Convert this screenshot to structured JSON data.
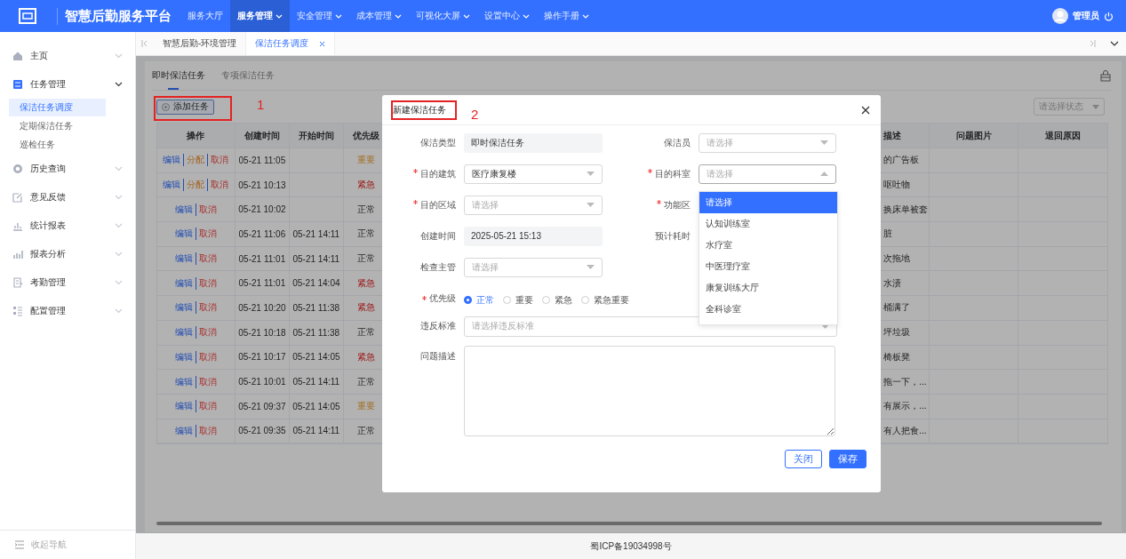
{
  "topbar": {
    "title": "智慧后勤服务平台",
    "user": "管理员",
    "nav": [
      {
        "label": "服务大厅",
        "selected": false,
        "dropdown": false
      },
      {
        "label": "服务管理",
        "selected": true,
        "dropdown": true
      },
      {
        "label": "安全管理",
        "selected": false,
        "dropdown": true
      },
      {
        "label": "成本管理",
        "selected": false,
        "dropdown": true
      },
      {
        "label": "可视化大屏",
        "selected": false,
        "dropdown": true
      },
      {
        "label": "设置中心",
        "selected": false,
        "dropdown": true
      },
      {
        "label": "操作手册",
        "selected": false,
        "dropdown": true
      }
    ]
  },
  "sidebar": {
    "collapse": "收起导航",
    "items": [
      {
        "label": "主页",
        "kind": "home",
        "expanded": false
      },
      {
        "label": "任务管理",
        "kind": "task",
        "expanded": true,
        "children": [
          {
            "label": "保洁任务调度",
            "selected": true
          },
          {
            "label": "定期保洁任务",
            "selected": false
          },
          {
            "label": "巡检任务",
            "selected": false
          }
        ]
      },
      {
        "label": "历史查询",
        "kind": "history",
        "expanded": false
      },
      {
        "label": "意见反馈",
        "kind": "feedback",
        "expanded": false
      },
      {
        "label": "统计报表",
        "kind": "stats",
        "expanded": false
      },
      {
        "label": "报表分析",
        "kind": "analysis",
        "expanded": false
      },
      {
        "label": "考勤管理",
        "kind": "attendance",
        "expanded": false
      },
      {
        "label": "配置管理",
        "kind": "config",
        "expanded": false
      }
    ]
  },
  "page_tabs": [
    {
      "label": "智慧后勤-环境管理",
      "selected": false
    },
    {
      "label": "保洁任务调度",
      "selected": true
    }
  ],
  "sub_tabs": [
    {
      "label": "即时保洁任务",
      "selected": true
    },
    {
      "label": "专项保洁任务",
      "selected": false
    }
  ],
  "add_button": "添加任务",
  "status_filter": {
    "placeholder": "请选择状态"
  },
  "table": {
    "columns": [
      "操作",
      "创建时间",
      "开始时间",
      "优先级",
      "描述",
      "问题图片",
      "退回原因"
    ],
    "rows": [
      {
        "actions": [
          {
            "label": "编辑",
            "kind": "edit"
          },
          {
            "label": "分配",
            "kind": "assign"
          },
          {
            "label": "取消",
            "kind": "cancel"
          }
        ],
        "created": "05-21 11:05",
        "priority": {
          "text": "重要",
          "kind": "important"
        },
        "description": "的广告板"
      },
      {
        "actions": [
          {
            "label": "编辑",
            "kind": "edit"
          },
          {
            "label": "分配",
            "kind": "assign"
          },
          {
            "label": "取消",
            "kind": "cancel"
          }
        ],
        "created": "05-21 10:13",
        "priority": {
          "text": "紧急",
          "kind": "urgent"
        },
        "description": "呕吐物"
      },
      {
        "actions": [
          {
            "label": "编辑",
            "kind": "edit"
          },
          {
            "label": "取消",
            "kind": "cancel"
          }
        ],
        "created": "05-21 10:02",
        "priority": {
          "text": "正常",
          "kind": "normal"
        },
        "description": "换床单被套"
      },
      {
        "actions": [
          {
            "label": "编辑",
            "kind": "edit"
          },
          {
            "label": "取消",
            "kind": "cancel"
          }
        ],
        "created": "05-21 11:06",
        "start": "05-21 14:11",
        "priority": {
          "text": "正常",
          "kind": "normal"
        },
        "description": "脏"
      },
      {
        "actions": [
          {
            "label": "编辑",
            "kind": "edit"
          },
          {
            "label": "取消",
            "kind": "cancel"
          }
        ],
        "created": "05-21 11:01",
        "start": "05-21 14:11",
        "priority": {
          "text": "正常",
          "kind": "normal"
        },
        "description": "次拖地"
      },
      {
        "actions": [
          {
            "label": "编辑",
            "kind": "edit"
          },
          {
            "label": "取消",
            "kind": "cancel"
          }
        ],
        "created": "05-21 11:01",
        "start": "05-21 14:04",
        "priority": {
          "text": "紧急",
          "kind": "urgent"
        },
        "description": "水渍"
      },
      {
        "actions": [
          {
            "label": "编辑",
            "kind": "edit"
          },
          {
            "label": "取消",
            "kind": "cancel"
          }
        ],
        "created": "05-21 10:20",
        "start": "05-21 11:38",
        "priority": {
          "text": "紧急",
          "kind": "urgent"
        },
        "description": "桶满了"
      },
      {
        "actions": [
          {
            "label": "编辑",
            "kind": "edit"
          },
          {
            "label": "取消",
            "kind": "cancel"
          }
        ],
        "created": "05-21 10:18",
        "start": "05-21 11:38",
        "priority": {
          "text": "正常",
          "kind": "normal"
        },
        "description": "坪垃圾"
      },
      {
        "actions": [
          {
            "label": "编辑",
            "kind": "edit"
          },
          {
            "label": "取消",
            "kind": "cancel"
          }
        ],
        "created": "05-21 10:17",
        "start": "05-21 14:05",
        "priority": {
          "text": "紧急",
          "kind": "urgent"
        },
        "description": "椅板凳"
      },
      {
        "actions": [
          {
            "label": "编辑",
            "kind": "edit"
          },
          {
            "label": "取消",
            "kind": "cancel"
          }
        ],
        "created": "05-21 10:01",
        "start": "05-21 14:11",
        "priority": {
          "text": "正常",
          "kind": "normal"
        },
        "description": "拖一下，..."
      },
      {
        "actions": [
          {
            "label": "编辑",
            "kind": "edit"
          },
          {
            "label": "取消",
            "kind": "cancel"
          }
        ],
        "created": "05-21 09:37",
        "start": "05-21 14:05",
        "priority": {
          "text": "重要",
          "kind": "important"
        },
        "description": "有展示，..."
      },
      {
        "actions": [
          {
            "label": "编辑",
            "kind": "edit"
          },
          {
            "label": "取消",
            "kind": "cancel"
          }
        ],
        "created": "05-21 09:35",
        "start": "05-21 14:11",
        "priority": {
          "text": "正常",
          "kind": "normal"
        },
        "description": "有人把食..."
      }
    ]
  },
  "annotations": [
    {
      "label": "1"
    },
    {
      "label": "2"
    }
  ],
  "modal": {
    "title": "新建保洁任务",
    "fields": [
      {
        "label": "保洁类型",
        "required": false,
        "kind": "readonly",
        "value": "即时保洁任务"
      },
      {
        "label": "保洁员",
        "required": false,
        "kind": "select",
        "placeholder": "请选择",
        "open": false
      },
      {
        "label": "目的建筑",
        "required": true,
        "kind": "select",
        "value": "医疗康复楼",
        "open": false
      },
      {
        "label": "目的科室",
        "required": true,
        "kind": "select",
        "placeholder": "请选择",
        "open": true
      },
      {
        "label": "目的区域",
        "required": true,
        "kind": "select",
        "placeholder": "请选择",
        "open": false
      },
      {
        "label": "功能区",
        "required": true
      },
      {
        "label": "创建时间",
        "required": false,
        "kind": "readonly",
        "value": "2025-05-21 15:13"
      },
      {
        "label": "预计耗时",
        "required": false
      },
      {
        "label": "检查主管",
        "required": false,
        "kind": "select",
        "placeholder": "请选择",
        "open": false
      }
    ],
    "priority": {
      "label": "优先级",
      "required": true,
      "options": [
        {
          "label": "正常",
          "selected": true
        },
        {
          "label": "重要",
          "selected": false
        },
        {
          "label": "紧急",
          "selected": false
        },
        {
          "label": "紧急重要",
          "selected": false
        }
      ]
    },
    "violation": {
      "label": "违反标准",
      "placeholder": "请选择违反标准"
    },
    "description": {
      "label": "问题描述"
    },
    "dropdown": {
      "options": [
        {
          "label": "请选择",
          "selected": true
        },
        {
          "label": "认知训练室",
          "selected": false
        },
        {
          "label": "水疗室",
          "selected": false
        },
        {
          "label": "中医理疗室",
          "selected": false
        },
        {
          "label": "康复训练大厅",
          "selected": false
        },
        {
          "label": "全科诊室",
          "selected": false
        }
      ]
    },
    "buttons": [
      {
        "label": "关闭",
        "kind": "secondary"
      },
      {
        "label": "保存",
        "kind": "primary"
      }
    ]
  },
  "footer": "蜀ICP备19034998号"
}
